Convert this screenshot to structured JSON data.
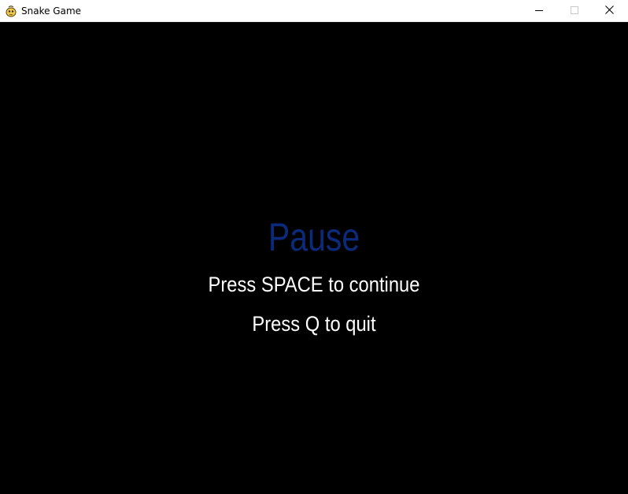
{
  "window": {
    "title": "Snake Game",
    "app_icon": "pygame-snake-icon",
    "controls": {
      "minimize_icon": "minimize-icon",
      "maximize_icon": "maximize-icon",
      "close_icon": "close-icon"
    }
  },
  "game": {
    "background_color": "#000000",
    "pause_title": "Pause",
    "pause_title_color": "#0b2a7a",
    "hint_color": "#ffffff",
    "hints": {
      "continue": "Press SPACE to continue",
      "quit": "Press Q to quit"
    }
  }
}
